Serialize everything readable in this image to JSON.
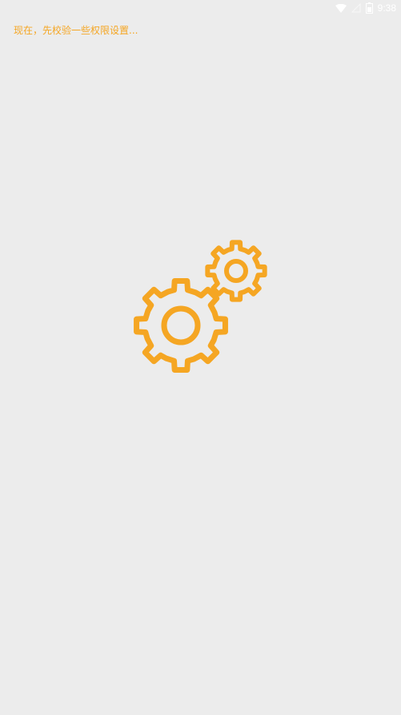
{
  "status_bar": {
    "time": "9:38",
    "icons": [
      "wifi-icon",
      "signal-icon",
      "battery-icon"
    ],
    "icon_color": "#ffffff"
  },
  "main": {
    "message": "现在，先校验一些权限设置...",
    "message_color": "#f5a623",
    "illustration": "gears-icon",
    "illustration_color": "#f5a623"
  },
  "background_color": "#ececec"
}
